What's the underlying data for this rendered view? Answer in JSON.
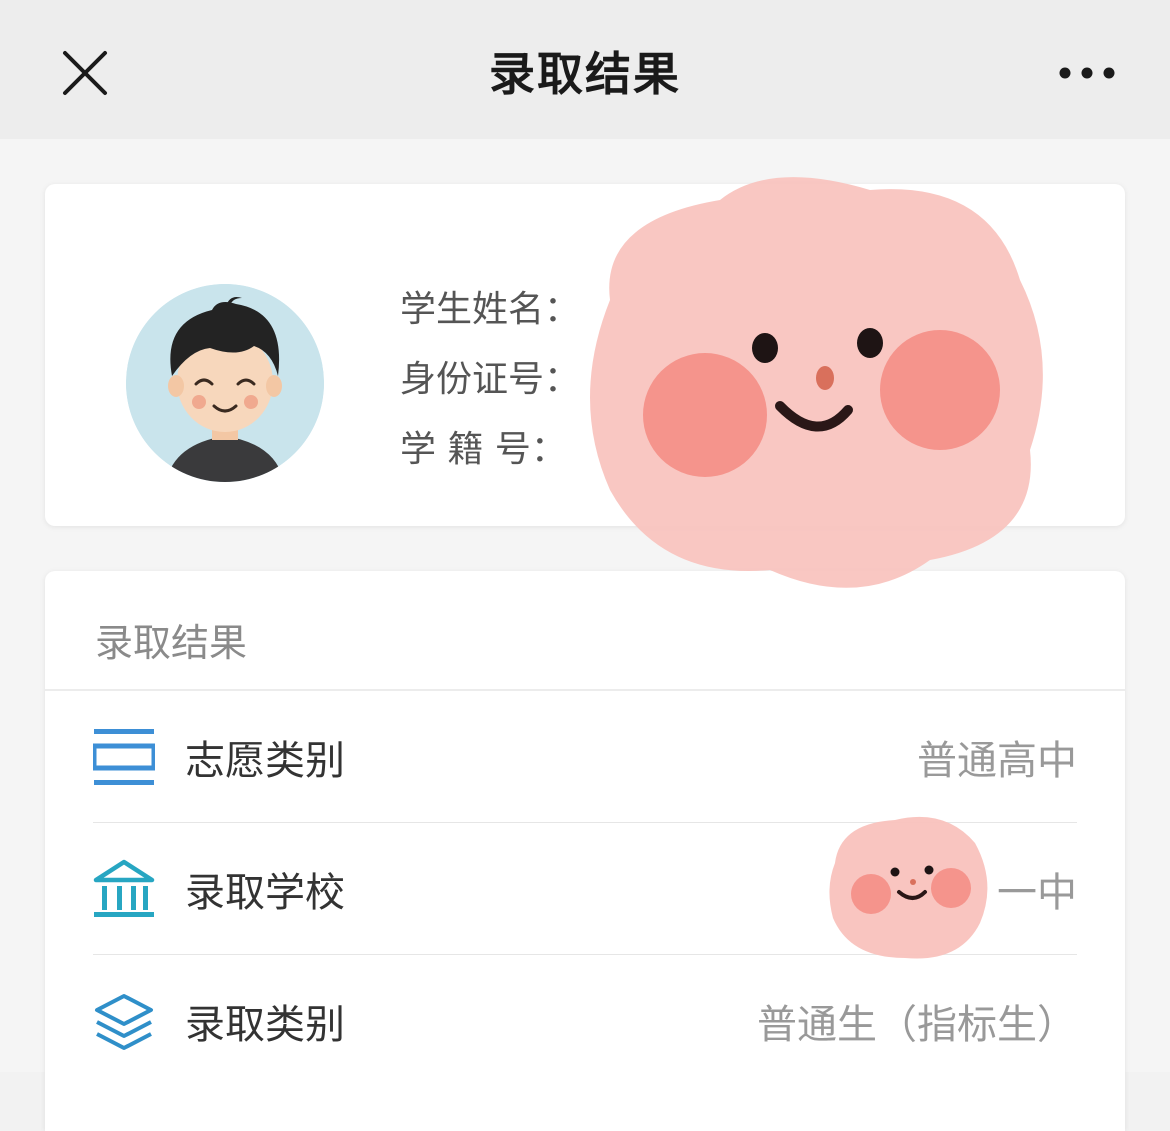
{
  "navbar": {
    "title": "录取结果",
    "close_icon": "close-icon",
    "more_icon": "more-dots-icon"
  },
  "profile": {
    "avatar_icon": "boy-avatar",
    "fields": [
      {
        "label": "学生姓名：",
        "value": ""
      },
      {
        "label": "身份证号：",
        "value": ""
      },
      {
        "label": "学 籍 号：",
        "value": ""
      }
    ]
  },
  "result": {
    "header": "录取结果",
    "rows": [
      {
        "icon": "list-frame-icon",
        "label": "志愿类别",
        "value": "普通高中"
      },
      {
        "icon": "school-building-icon",
        "label": "录取学校",
        "value": "一中"
      },
      {
        "icon": "layers-icon",
        "label": "录取类别",
        "value": "普通生（指标生）"
      }
    ]
  },
  "colors": {
    "nav_bg": "#ededed",
    "icon_blue": "#3d8fd6",
    "icon_teal": "#27a6c2",
    "sticker_pink": "#f9c2bd"
  }
}
